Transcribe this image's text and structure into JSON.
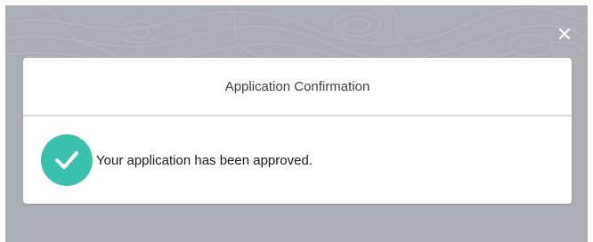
{
  "overlay": {
    "close_icon": "close-icon",
    "background_color": "#a9adb4"
  },
  "modal": {
    "title": "Application Confirmation",
    "message": "Your application has been approved.",
    "status_icon": "check-circle-icon",
    "accent_color": "#3bc0ae"
  }
}
